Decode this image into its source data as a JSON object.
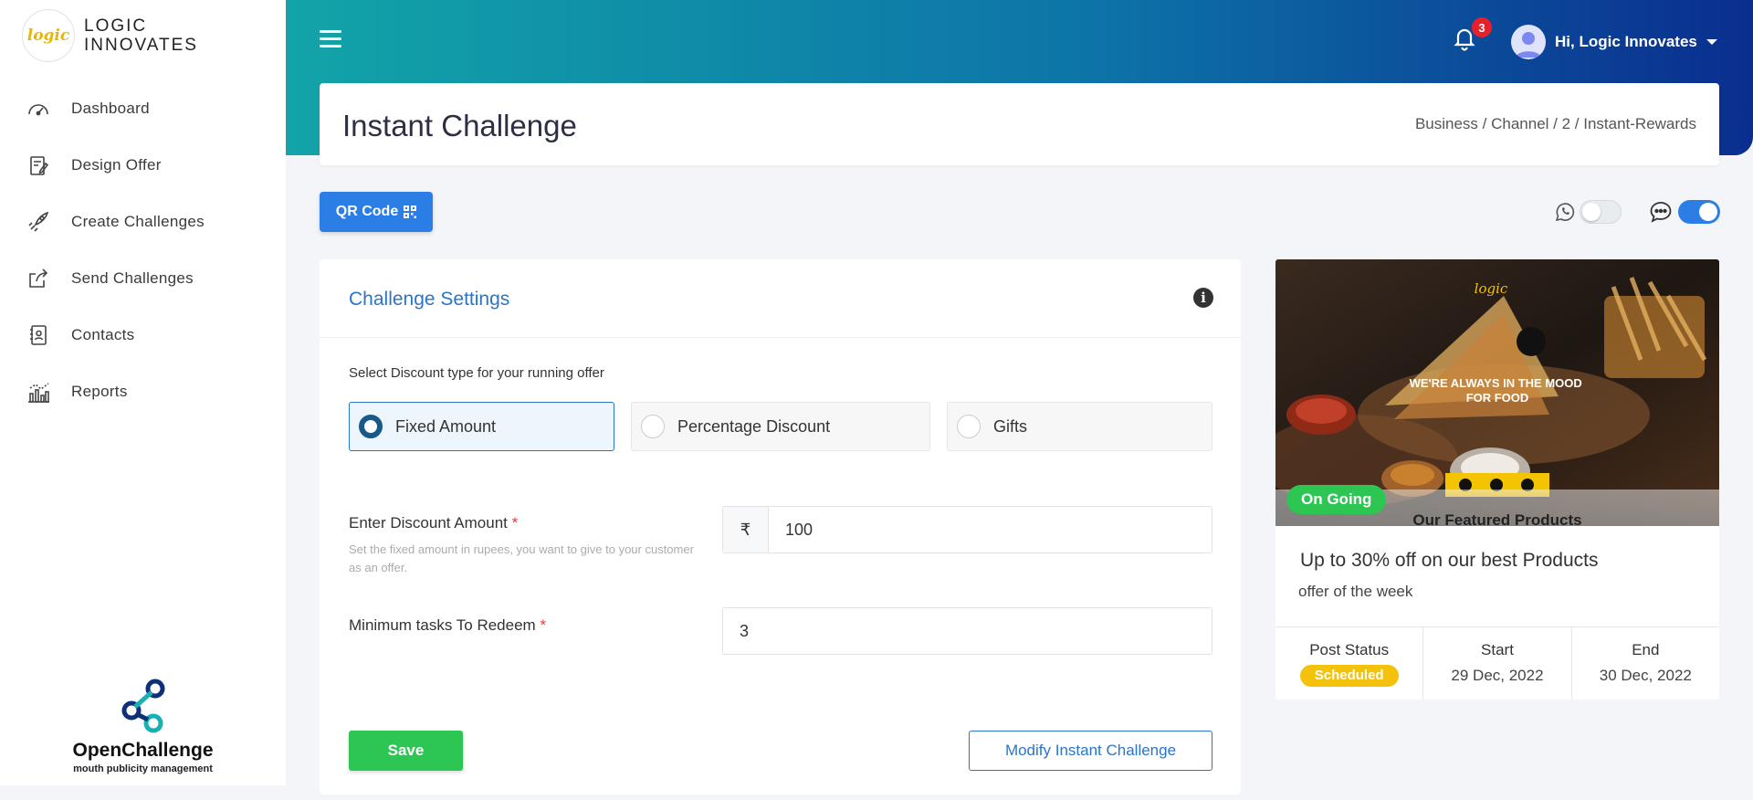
{
  "brand": {
    "logo_text": "logic",
    "name_line1": "LOGIC",
    "name_line2": "INNOVATES"
  },
  "sidebar": {
    "items": [
      {
        "label": "Dashboard",
        "icon": "speedometer-icon"
      },
      {
        "label": "Design Offer",
        "icon": "design-document-icon"
      },
      {
        "label": "Create Challenges",
        "icon": "rocket-icon"
      },
      {
        "label": "Send Challenges",
        "icon": "share-icon"
      },
      {
        "label": "Contacts",
        "icon": "contact-book-icon"
      },
      {
        "label": "Reports",
        "icon": "bar-chart-icon"
      }
    ],
    "footer": {
      "name": "OpenChallenge",
      "tagline": "mouth publicity management"
    }
  },
  "header": {
    "notification_count": "3",
    "user_greeting": "Hi, Logic Innovates"
  },
  "page": {
    "title": "Instant Challenge",
    "breadcrumb": "Business / Channel / 2 / Instant-Rewards"
  },
  "toolbar": {
    "qr_label": "QR Code",
    "whatsapp_enabled": false,
    "sms_enabled": true
  },
  "settings": {
    "title": "Challenge Settings",
    "discount_prompt": "Select Discount type for your running offer",
    "discount_options": [
      {
        "label": "Fixed Amount",
        "selected": true
      },
      {
        "label": "Percentage Discount",
        "selected": false
      },
      {
        "label": "Gifts",
        "selected": false
      }
    ],
    "amount_label": "Enter Discount Amount",
    "required_mark": "*",
    "amount_hint": "Set the fixed amount in rupees, you want to give to your customer as an offer.",
    "currency_symbol": "₹",
    "amount_value": "100",
    "tasks_label": "Minimum tasks To Redeem",
    "tasks_value": "3",
    "save_label": "Save",
    "modify_label": "Modify Instant Challenge"
  },
  "preview": {
    "banner_logo": "logic",
    "banner_headline": "WE'RE ALWAYS IN THE MOOD FOR FOOD",
    "banner_footer": "Our Featured Products",
    "status_pill": "On Going",
    "offer_title": "Up to 30% off on our best Products",
    "offer_subtitle": "offer of the week",
    "post_status_label": "Post Status",
    "post_status_value": "Scheduled",
    "start_label": "Start",
    "start_value": "29 Dec, 2022",
    "end_label": "End",
    "end_value": "30 Dec, 2022"
  },
  "colors": {
    "primary": "#2a7ee6",
    "success": "#2dc653",
    "warning": "#f5c20b",
    "danger": "#e8202a"
  }
}
